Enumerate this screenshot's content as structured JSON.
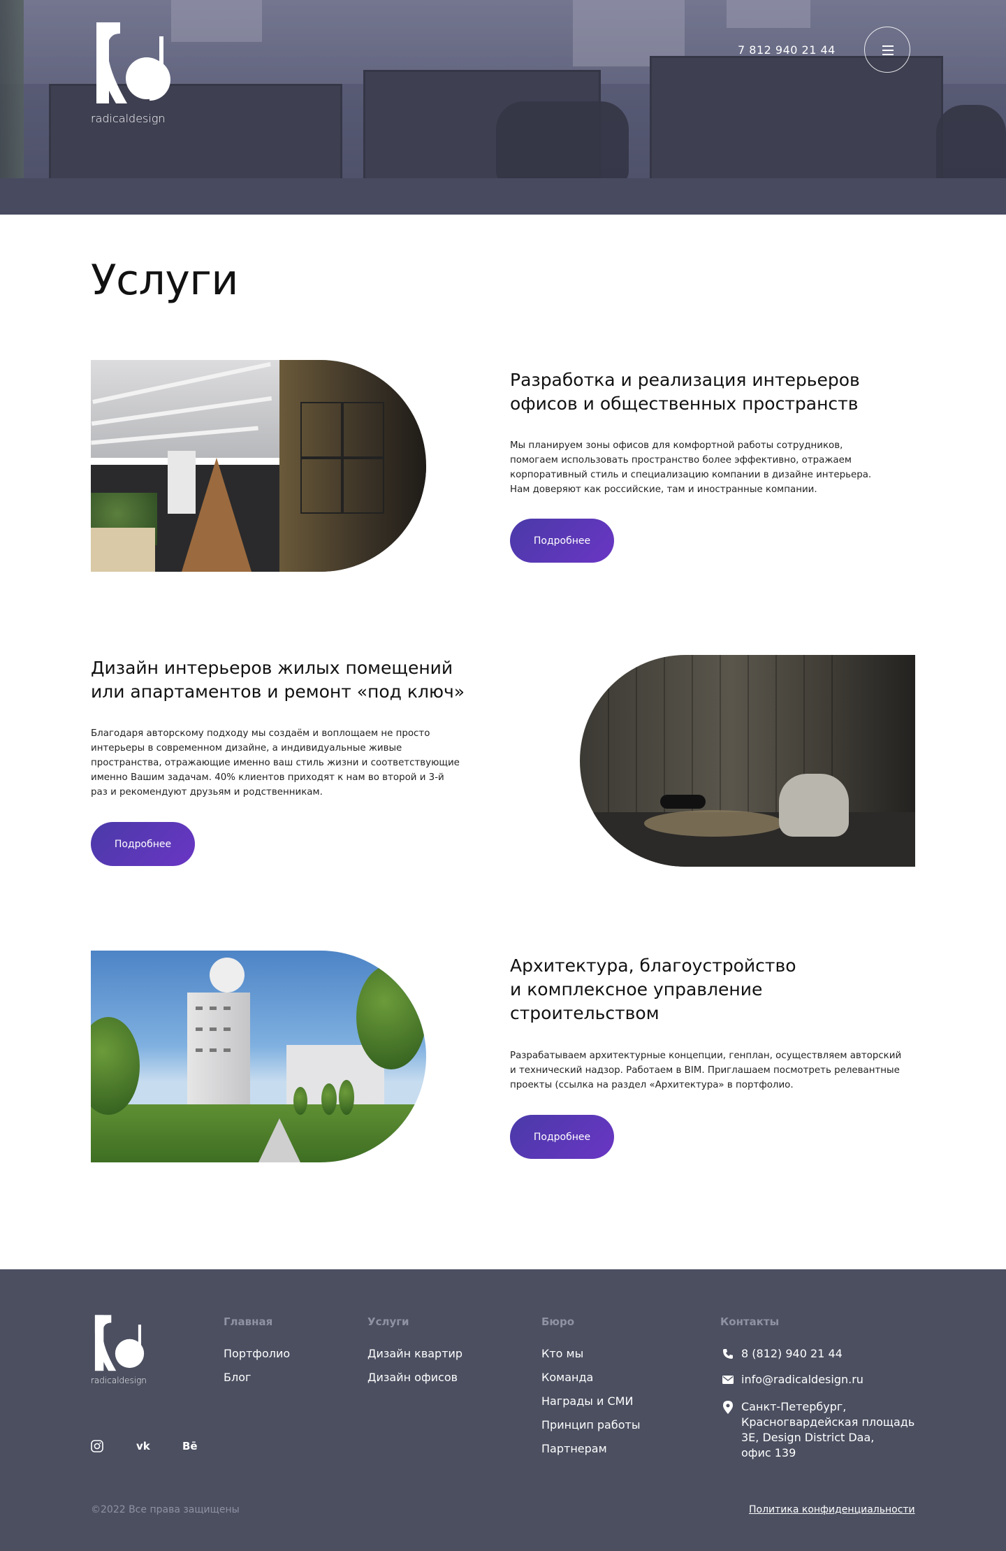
{
  "brand": {
    "name": "radicaldesign"
  },
  "header": {
    "phone": "7 812 940 21 44",
    "menu_icon": "hamburger-icon"
  },
  "main": {
    "title": "Услуги",
    "services": [
      {
        "title": "Разработка и реализация интерьеров\nофисов и общественных пространств",
        "description": "Мы планируем зоны офисов для комфортной работы сотрудников,\nпомогаем использовать пространство более эффективно, отражаем\nкорпоративный стиль и специализацию компании в дизайне интерьера.\nНам доверяют как российские, там и иностранные компании.",
        "button": "Подробнее"
      },
      {
        "title": "Дизайн интерьеров жилых помещений\nили апартаментов и ремонт «под ключ»",
        "description": "Благодаря авторскому подходу мы создаём и воплощаем не просто\nинтерьеры в современном дизайне, а индивидуальные живые\nпространства, отражающие именно ваш стиль жизни и соответствующие\nименно Вашим задачам. 40% клиентов приходят к нам во второй и 3-й\nраз и рекомендуют друзьям и родственникам.",
        "button": "Подробнее"
      },
      {
        "title": "Архитектура, благоустройство\nи комплексное управление\nстроительством",
        "description": "Разрабатываем архитектурные концепции, генплан, осуществляем авторский\nи технический надзор. Работаем в BIM. Приглашаем посмотреть релевантные\nпроекты (ссылка на раздел «Архитектура» в портфолио.",
        "button": "Подробнее"
      }
    ],
    "button_gradient": [
      "#4a3aa8",
      "#6a36c4"
    ]
  },
  "footer": {
    "columns": [
      {
        "heading": "Главная",
        "links": [
          "Портфолио",
          "Блог"
        ]
      },
      {
        "heading": "Услуги",
        "links": [
          "Дизайн квартир",
          "Дизайн офисов"
        ]
      },
      {
        "heading": "Бюро",
        "links": [
          "Кто мы",
          "Команда",
          "Награды и СМИ",
          "Принцип работы",
          "Партнерам"
        ]
      }
    ],
    "contacts": {
      "heading": "Контакты",
      "phone": "8 (812) 940 21 44",
      "email": "info@radicaldesign.ru",
      "address": "Санкт-Петербург,\nКрасногвардейская площадь\n3Е, Design District Daa,\nофис 139"
    },
    "social": [
      "instagram-icon",
      "vk-icon",
      "behance-icon"
    ],
    "social_labels": {
      "vk": "vk",
      "behance": "Bē"
    },
    "copyright": "©2022 Все права защищены",
    "privacy": "Политика конфиденциальности",
    "background": "#4b4f60"
  }
}
